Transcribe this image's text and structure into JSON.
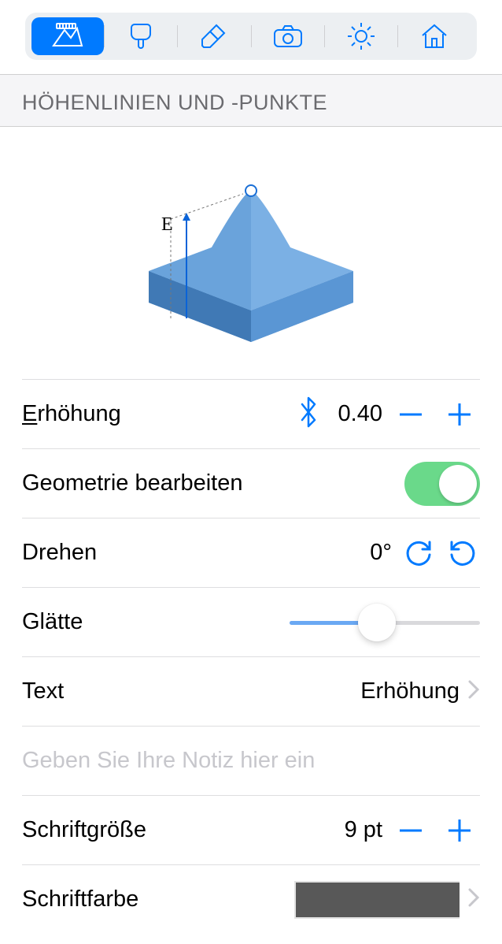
{
  "section_title": "HÖHENLINIEN UND -PUNKTE",
  "illustration_label": "E",
  "rows": {
    "elevation_label": "rhöhung",
    "elevation_prefix": "E",
    "elevation_value": "0.40",
    "geometry_label": "Geometrie bearbeiten",
    "rotate_label": "Drehen",
    "rotate_value": "0°",
    "smooth_label": "Glätte",
    "text_label": "Text",
    "text_value": "Erhöhung",
    "note_placeholder": "Geben Sie Ihre Notiz hier ein",
    "fontsize_label": "Schriftgröße",
    "fontsize_value": "9 pt",
    "fontcolor_label": "Schriftfarbe"
  },
  "colors": {
    "swatch": "#585858"
  },
  "toolbar_icons": [
    "terrain-icon",
    "brush-icon",
    "eraser-icon",
    "camera-icon",
    "sun-icon",
    "house-icon"
  ]
}
